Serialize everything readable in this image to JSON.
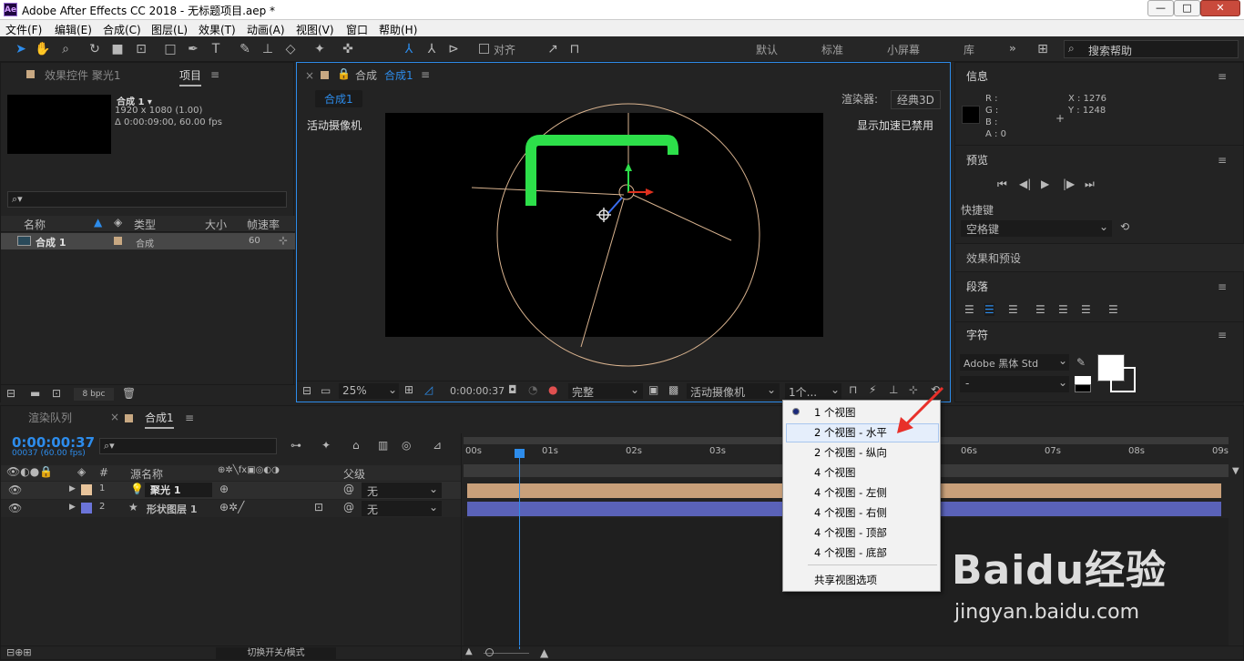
{
  "app": {
    "title": "Adobe After Effects CC 2018 - 无标题项目.aep *",
    "logo": "Ae"
  },
  "window_controls": {
    "minimize": "—",
    "maximize": "□",
    "close": "✕"
  },
  "menu": [
    "文件(F)",
    "编辑(E)",
    "合成(C)",
    "图层(L)",
    "效果(T)",
    "动画(A)",
    "视图(V)",
    "窗口",
    "帮助(H)"
  ],
  "toolbar": {
    "align_label": "对齐",
    "workspaces": [
      "默认",
      "标准",
      "小屏幕",
      "库"
    ],
    "more": "»",
    "search_placeholder": "搜索帮助"
  },
  "project_panel": {
    "tab_effects": "效果控件 聚光1",
    "tab_project": "项目",
    "comp_name": "合成 1 ▾",
    "comp_size": "1920 x 1080 (1.00)",
    "comp_duration": "Δ 0:00:09:00, 60.00 fps",
    "search_placeholder": "",
    "columns": [
      "名称",
      "类型",
      "大小",
      "帧速率"
    ],
    "rows": [
      {
        "name": "合成 1",
        "type": "合成",
        "size": "",
        "fps": "60"
      }
    ],
    "bpc": "8 bpc"
  },
  "comp_panel": {
    "tab_prefix": "合成",
    "tab_name": "合成1",
    "sub_tab": "合成1",
    "renderer_label": "渲染器:",
    "renderer_value": "经典3D",
    "camera_label": "活动摄像机",
    "accel_label": "显示加速已禁用",
    "zoom": "25%",
    "timecode": "0:00:00:37",
    "quality": "完整",
    "camera_select": "活动摄像机",
    "views_select": "1个..."
  },
  "dropdown": {
    "items": [
      {
        "label": "1 个视图",
        "selected": true
      },
      {
        "label": "2 个视图 - 水平",
        "highlighted": true
      },
      {
        "label": "2 个视图 - 纵向"
      },
      {
        "label": "4 个视图"
      },
      {
        "label": "4 个视图 - 左侧"
      },
      {
        "label": "4 个视图 - 右侧"
      },
      {
        "label": "4 个视图 - 顶部"
      },
      {
        "label": "4 个视图 - 底部"
      }
    ],
    "shared": "共享视图选项"
  },
  "right_panel": {
    "info_title": "信息",
    "r": "R :",
    "g": "G :",
    "b": "B :",
    "a": "A : 0",
    "x": "X : 1276",
    "y": "Y : 1248",
    "preview_title": "预览",
    "shortcut_label": "快捷键",
    "shortcut_value": "空格键",
    "effects_title": "效果和预设",
    "paragraph_title": "段落",
    "character_title": "字符",
    "font_name": "Adobe 黑体 Std",
    "font_style": "-"
  },
  "timeline": {
    "tab_render": "渲染队列",
    "tab_comp": "合成1",
    "timecode": "0:00:00:37",
    "frame_info": "00037 (60.00 fps)",
    "columns": {
      "num": "#",
      "source": "源名称",
      "parent": "父级"
    },
    "layers": [
      {
        "num": "1",
        "name": "聚光 1",
        "parent": "无",
        "color": "#e8c49b"
      },
      {
        "num": "2",
        "name": "形状图层 1",
        "parent": "无",
        "color": "#6b74d8"
      }
    ],
    "ruler": [
      "00s",
      "01s",
      "02s",
      "03s",
      "06s",
      "07s",
      "08s",
      "09s"
    ],
    "footer": "切换开关/模式"
  },
  "watermark": {
    "brand": "Baidu经验",
    "url": "jingyan.baidu.com"
  },
  "colors": {
    "accent": "#2d8ceb",
    "panel": "#232323",
    "selection_green": "#2ddf4a"
  }
}
